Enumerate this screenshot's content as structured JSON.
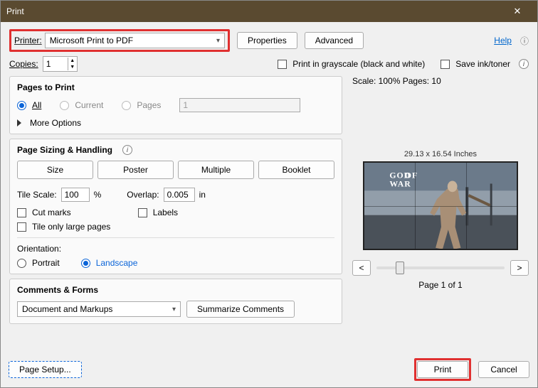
{
  "titlebar": {
    "title": "Print"
  },
  "printer": {
    "label": "Printer:",
    "selected": "Microsoft Print to PDF",
    "properties_btn": "Properties",
    "advanced_btn": "Advanced",
    "help_link": "Help"
  },
  "copies": {
    "label": "Copies:",
    "value": "1",
    "grayscale_label": "Print in grayscale (black and white)",
    "save_ink_label": "Save ink/toner"
  },
  "pages_to_print": {
    "title": "Pages to Print",
    "all": "All",
    "current": "Current",
    "pages": "Pages",
    "pages_value": "1",
    "more_options": "More Options"
  },
  "sizing": {
    "title": "Page Sizing & Handling",
    "size": "Size",
    "poster": "Poster",
    "multiple": "Multiple",
    "booklet": "Booklet",
    "tile_scale_label": "Tile Scale:",
    "tile_scale_value": "100",
    "tile_scale_unit": "%",
    "overlap_label": "Overlap:",
    "overlap_value": "0.005",
    "overlap_unit": "in",
    "cut_marks": "Cut marks",
    "labels": "Labels",
    "tile_large": "Tile only large pages"
  },
  "orientation": {
    "title": "Orientation:",
    "portrait": "Portrait",
    "landscape": "Landscape"
  },
  "comments": {
    "title": "Comments & Forms",
    "selected": "Document and Markups",
    "summarize_btn": "Summarize Comments"
  },
  "preview": {
    "scale_pages": "Scale: 100% Pages: 10",
    "dimensions": "29.13 x 16.54 Inches",
    "logo_top": "GOD",
    "logo_bottom": "WAR",
    "logo_of": "OF",
    "page_indicator": "Page 1 of 1",
    "prev": "<",
    "next": ">"
  },
  "footer": {
    "page_setup": "Page Setup...",
    "print": "Print",
    "cancel": "Cancel"
  }
}
